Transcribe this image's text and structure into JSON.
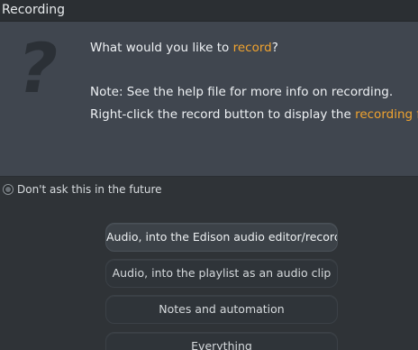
{
  "window": {
    "title": "Recording"
  },
  "message": {
    "question_icon": "question-mark-icon",
    "question_prefix": "What would you like to ",
    "question_link": "record",
    "question_suffix": "?",
    "note_line1": "Note: See the help file for more info on recording.",
    "note_line2_prefix": "Right-click the record button to display the ",
    "note_line2_link": "recording filte"
  },
  "options": {
    "dont_ask_label": "Don't ask this in the future"
  },
  "choices": [
    {
      "label": "Audio, into the Edison audio editor/recorder"
    },
    {
      "label": "Audio, into the playlist as an audio clip"
    },
    {
      "label": "Notes and automation"
    },
    {
      "label": "Everything"
    }
  ],
  "colors": {
    "accent": "#f0a32f",
    "panel": "#40464f",
    "background": "#2f3337"
  }
}
